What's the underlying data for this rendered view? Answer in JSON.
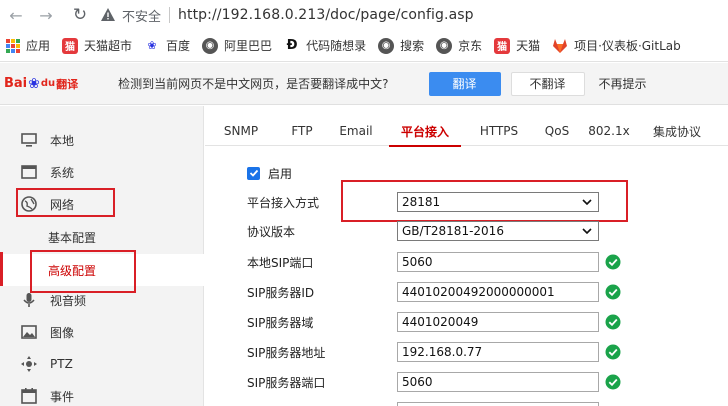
{
  "browser": {
    "insecure_label": "不安全",
    "url": "http://192.168.0.213/doc/page/config.asp"
  },
  "bookmarks": [
    {
      "label": "应用",
      "icon": "apps-icon"
    },
    {
      "label": "天猫超市",
      "icon": "tmall-icon"
    },
    {
      "label": "百度",
      "icon": "baidu-paw-icon"
    },
    {
      "label": "阿里巴巴",
      "icon": "globe-icon"
    },
    {
      "label": "代码随想录",
      "icon": "letter-d-icon"
    },
    {
      "label": "搜索",
      "icon": "globe-icon"
    },
    {
      "label": "京东",
      "icon": "globe-icon"
    },
    {
      "label": "天猫",
      "icon": "tmall-icon"
    },
    {
      "label": "项目·仪表板·GitLab",
      "icon": "gitlab-fox-icon"
    }
  ],
  "translate_bar": {
    "logo_text": "Bai",
    "logo_text2": "du",
    "logo_text3": "翻译",
    "message": "检测到当前网页不是中文网页，是否要翻译成中文?",
    "translate_label": "翻译",
    "no_translate_label": "不翻译",
    "never_label": "不再提示"
  },
  "sidebar": {
    "items": [
      {
        "label": "本地",
        "icon": "monitor-icon"
      },
      {
        "label": "系统",
        "icon": "window-icon"
      },
      {
        "label": "网络",
        "icon": "globe-icon"
      },
      {
        "label": "视音频",
        "icon": "mic-icon"
      },
      {
        "label": "图像",
        "icon": "image-icon"
      },
      {
        "label": "PTZ",
        "icon": "ptz-icon"
      },
      {
        "label": "事件",
        "icon": "calendar-icon"
      }
    ],
    "sub_items": [
      {
        "label": "基本配置"
      },
      {
        "label": "高级配置"
      }
    ]
  },
  "tabs": [
    {
      "label": "SNMP"
    },
    {
      "label": "FTP"
    },
    {
      "label": "Email"
    },
    {
      "label": "平台接入"
    },
    {
      "label": "HTTPS"
    },
    {
      "label": "QoS"
    },
    {
      "label": "802.1x"
    },
    {
      "label": "集成协议"
    }
  ],
  "form": {
    "enable_label": "启用",
    "rows": [
      {
        "label": "平台接入方式",
        "value": "28181"
      },
      {
        "label": "协议版本",
        "value": "GB/T28181-2016"
      },
      {
        "label": "本地SIP端口",
        "value": "5060"
      },
      {
        "label": "SIP服务器ID",
        "value": "44010200492000000001"
      },
      {
        "label": "SIP服务器域",
        "value": "4401020049"
      },
      {
        "label": "SIP服务器地址",
        "value": "192.168.0.77"
      },
      {
        "label": "SIP服务器端口",
        "value": "5060"
      }
    ]
  },
  "colors": {
    "accent_red": "#c00000",
    "annotation_red": "#d91f26",
    "translate_blue": "#3b8cf0",
    "check_green": "#1aa34a"
  }
}
